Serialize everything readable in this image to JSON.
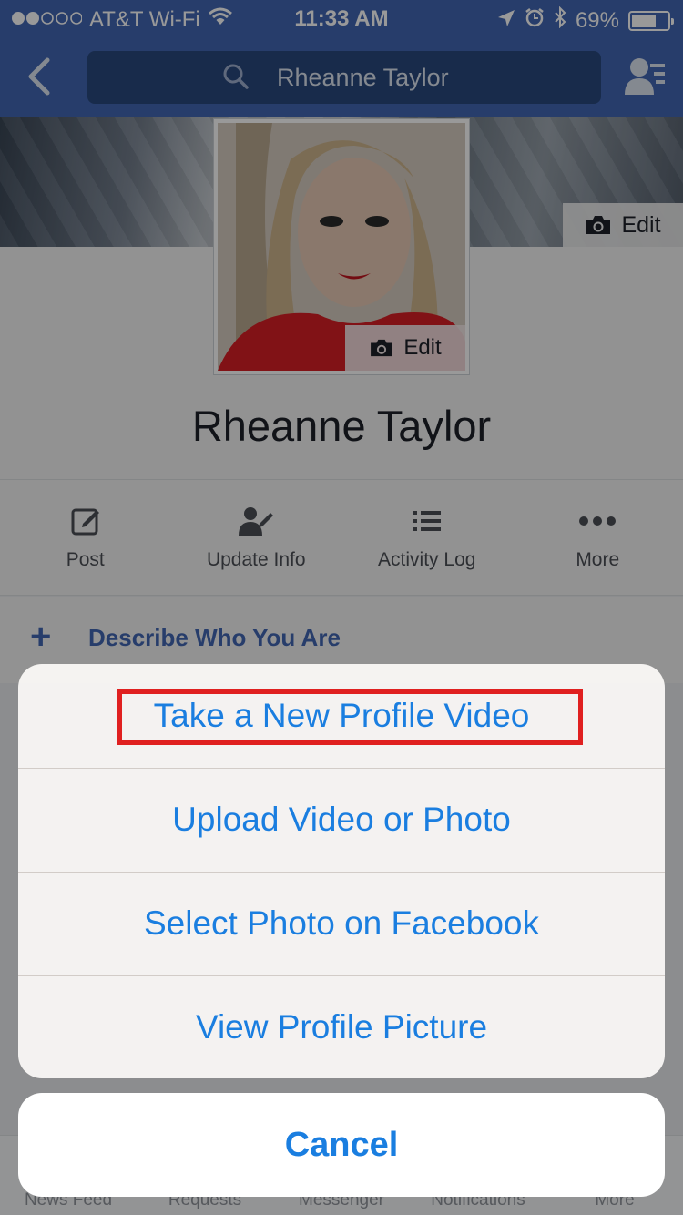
{
  "status_bar": {
    "carrier": "AT&T Wi-Fi",
    "time": "11:33 AM",
    "battery": "69%",
    "battery_level": 0.69,
    "signal_bars_filled": 2,
    "signal_bars_total": 5,
    "icons": [
      "wifi-icon",
      "location-arrow-icon",
      "alarm-icon",
      "bluetooth-icon",
      "battery-icon"
    ]
  },
  "nav": {
    "search_value": "Rheanne Taylor",
    "icons": [
      "back-chevron-icon",
      "search-icon",
      "friend-requests-icon"
    ]
  },
  "profile": {
    "name": "Rheanne Taylor",
    "cover_edit_label": "Edit",
    "avatar_edit_label": "Edit"
  },
  "actions": [
    {
      "label": "Post",
      "icon": "compose-icon"
    },
    {
      "label": "Update Info",
      "icon": "edit-person-icon"
    },
    {
      "label": "Activity Log",
      "icon": "list-icon"
    },
    {
      "label": "More",
      "icon": "more-dots-icon"
    }
  ],
  "describe": {
    "label": "Describe Who You Are"
  },
  "tabs": [
    "News Feed",
    "Requests",
    "Messenger",
    "Notifications",
    "More"
  ],
  "sheet": {
    "items": [
      "Take a New Profile Video",
      "Upload Video or Photo",
      "Select Photo on Facebook",
      "View Profile Picture"
    ],
    "cancel": "Cancel"
  },
  "colors": {
    "facebook_blue": "#4267b2",
    "ios_blue": "#1a7ee0",
    "highlight_red": "#e02020"
  }
}
